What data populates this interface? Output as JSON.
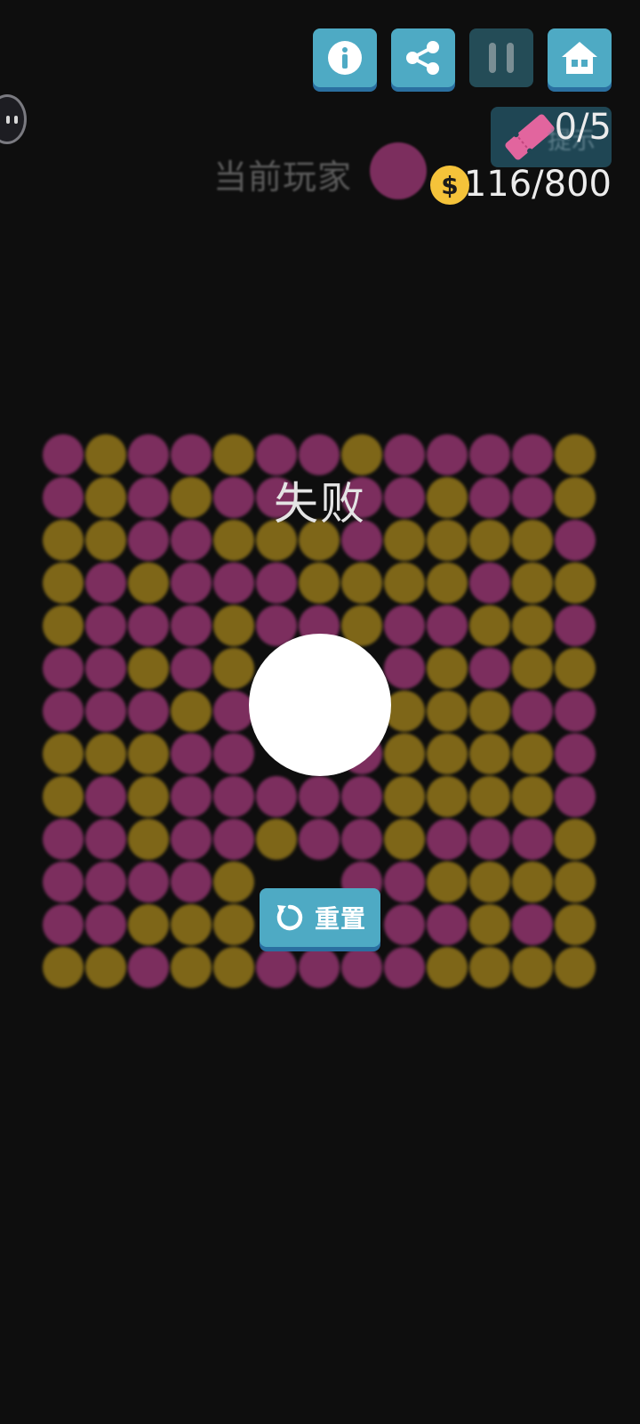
{
  "toolbar": {
    "info_icon": "info-icon",
    "share_icon": "share-icon",
    "pause_icon": "pause-icon",
    "home_icon": "home-icon"
  },
  "hint": {
    "label": "提示",
    "count": "0/5"
  },
  "player": {
    "label": "当前玩家",
    "color": "#7c2e5e"
  },
  "coins": {
    "symbol": "$",
    "count": "116/800"
  },
  "board": {
    "colors": {
      "m": "#7c2e5e",
      "y": "#7e6618"
    },
    "rows": [
      "mymmymmymmmmy",
      "mymymm?mmymmy",
      "yymmyyymyyyym",
      "ymymmmyyyymyy",
      "ymmmymmymmyym",
      "mmymy???mymyy",
      "mmmym??yyyymm",
      "yyymm??myyyym",
      "ymymmmmmyyyym",
      "mmymmymmymmmy",
      "mmmmy??mmyyyy",
      "mmyyy???mmymy",
      "yymyymmmmyyyy"
    ]
  },
  "result": {
    "title": "失败"
  },
  "reset": {
    "label": "重置"
  }
}
